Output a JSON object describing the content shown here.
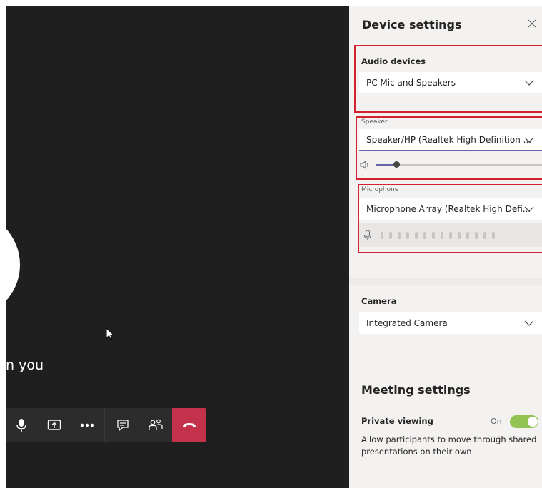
{
  "stage": {
    "caption": "n you"
  },
  "toolbar": {
    "buttons": [
      "mic-icon",
      "share-tray-icon",
      "more-icon",
      "chat-icon",
      "participants-icon",
      "hangup-icon"
    ]
  },
  "panel": {
    "title": "Device settings",
    "audio_devices": {
      "label": "Audio devices",
      "value": "PC Mic and Speakers"
    },
    "speaker": {
      "label": "Speaker",
      "value": "Speaker/HP (Realtek High Definition ...",
      "volume": 0.12
    },
    "microphone": {
      "label": "Microphone",
      "value": "Microphone Array (Realtek High Defi..."
    },
    "camera": {
      "label": "Camera",
      "value": "Integrated Camera"
    }
  },
  "meeting_settings": {
    "title": "Meeting settings",
    "private_viewing": {
      "label": "Private viewing",
      "state": "On",
      "enabled": true,
      "description": "Allow participants to move through shared presentations on their own"
    }
  },
  "colors": {
    "stage_bg": "#1f1f1f",
    "toolbar_bg": "#2d2c2c",
    "hangup": "#c4314b",
    "accent": "#6264a7",
    "toggle_on": "#92c353",
    "annotation_box": "#d4232f"
  }
}
